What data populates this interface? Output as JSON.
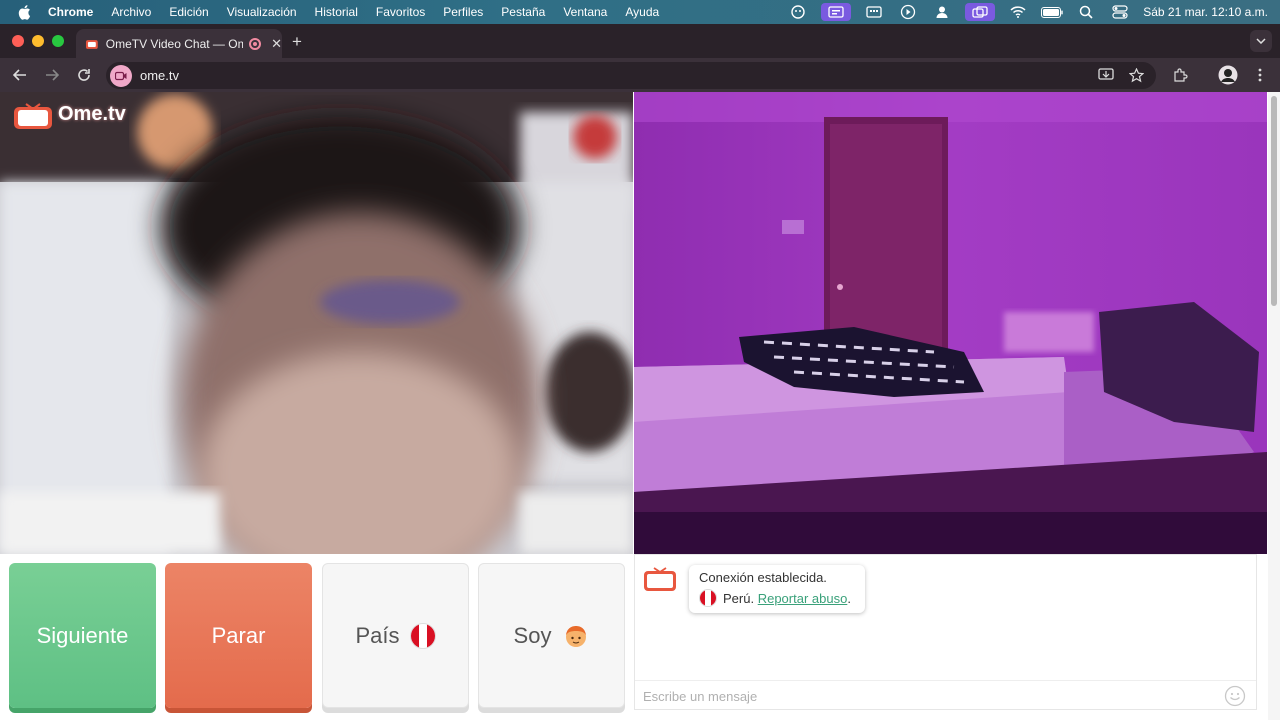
{
  "menubar": {
    "app_name": "Chrome",
    "items": [
      "Archivo",
      "Edición",
      "Visualización",
      "Historial",
      "Favoritos",
      "Perfiles",
      "Pestaña",
      "Ventana",
      "Ayuda"
    ],
    "clock": "Sáb 21 mar.  12:10 a.m."
  },
  "browser": {
    "tab_title": "OmeTV Video Chat — Ome",
    "url": "ome.tv",
    "accent": "#f0a8c8"
  },
  "page": {
    "logo_text": "Ome.tv",
    "buttons": {
      "next": "Siguiente",
      "stop": "Parar",
      "country": "País",
      "gender": "Soy"
    },
    "chat": {
      "status": "Conexión establecida.",
      "country": "Perú.",
      "report_link": "Reportar abuso",
      "report_suffix": ".",
      "placeholder": "Escribe un mensaje"
    },
    "colors": {
      "next": "#5ec084",
      "stop": "#e46b4c",
      "peru_red": "#d91023"
    }
  }
}
